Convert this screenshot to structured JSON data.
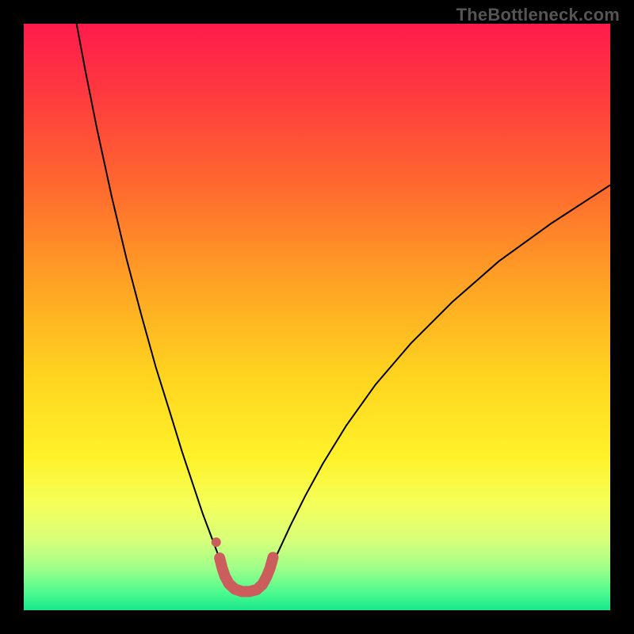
{
  "watermark": "TheBottleneck.com",
  "chart_data": {
    "type": "line",
    "title": "",
    "xlabel": "",
    "ylabel": "",
    "xlim": [
      0,
      100
    ],
    "ylim": [
      0,
      100
    ],
    "gradient_stops": [
      {
        "offset": 0,
        "color": "#ff1b4d"
      },
      {
        "offset": 12,
        "color": "#ff3a3f"
      },
      {
        "offset": 28,
        "color": "#ff6a2e"
      },
      {
        "offset": 45,
        "color": "#ffa524"
      },
      {
        "offset": 60,
        "color": "#ffd41f"
      },
      {
        "offset": 74,
        "color": "#fff22a"
      },
      {
        "offset": 82,
        "color": "#f4ff5a"
      },
      {
        "offset": 88,
        "color": "#d8ff7a"
      },
      {
        "offset": 93,
        "color": "#9cff8a"
      },
      {
        "offset": 97,
        "color": "#4dfb8e"
      },
      {
        "offset": 100,
        "color": "#17e78b"
      }
    ],
    "series": [
      {
        "name": "curve-left",
        "color": "#000000",
        "width": 2,
        "points": [
          {
            "x": 9.0,
            "y": 100.0
          },
          {
            "x": 10.5,
            "y": 92.0
          },
          {
            "x": 12.5,
            "y": 82.0
          },
          {
            "x": 15.0,
            "y": 70.5
          },
          {
            "x": 17.5,
            "y": 60.0
          },
          {
            "x": 20.0,
            "y": 50.5
          },
          {
            "x": 22.5,
            "y": 41.5
          },
          {
            "x": 25.0,
            "y": 33.5
          },
          {
            "x": 27.0,
            "y": 27.0
          },
          {
            "x": 29.0,
            "y": 21.0
          },
          {
            "x": 30.5,
            "y": 16.5
          },
          {
            "x": 32.0,
            "y": 12.5
          },
          {
            "x": 33.2,
            "y": 9.3
          },
          {
            "x": 34.0,
            "y": 7.1
          }
        ]
      },
      {
        "name": "curve-right",
        "color": "#000000",
        "width": 2,
        "points": [
          {
            "x": 42.0,
            "y": 7.0
          },
          {
            "x": 43.5,
            "y": 10.2
          },
          {
            "x": 45.5,
            "y": 14.5
          },
          {
            "x": 48.0,
            "y": 19.5
          },
          {
            "x": 51.0,
            "y": 25.0
          },
          {
            "x": 55.0,
            "y": 31.5
          },
          {
            "x": 60.0,
            "y": 38.5
          },
          {
            "x": 66.0,
            "y": 45.5
          },
          {
            "x": 73.0,
            "y": 52.5
          },
          {
            "x": 81.0,
            "y": 59.5
          },
          {
            "x": 90.0,
            "y": 66.0
          },
          {
            "x": 100.0,
            "y": 72.5
          }
        ]
      },
      {
        "name": "bottom-u",
        "color": "#cb5d5d",
        "width": 14,
        "linecap": "round",
        "points": [
          {
            "x": 33.4,
            "y": 8.9
          },
          {
            "x": 33.8,
            "y": 7.3
          },
          {
            "x": 34.3,
            "y": 5.8
          },
          {
            "x": 35.0,
            "y": 4.5
          },
          {
            "x": 36.0,
            "y": 3.6
          },
          {
            "x": 37.2,
            "y": 3.2
          },
          {
            "x": 38.5,
            "y": 3.2
          },
          {
            "x": 39.7,
            "y": 3.5
          },
          {
            "x": 40.7,
            "y": 4.4
          },
          {
            "x": 41.4,
            "y": 5.7
          },
          {
            "x": 42.0,
            "y": 7.2
          },
          {
            "x": 42.5,
            "y": 9.0
          }
        ]
      }
    ],
    "markers": [
      {
        "name": "dot-top-left-u",
        "x": 32.8,
        "y": 11.6,
        "r": 6,
        "color": "#cb5d5d"
      }
    ]
  }
}
